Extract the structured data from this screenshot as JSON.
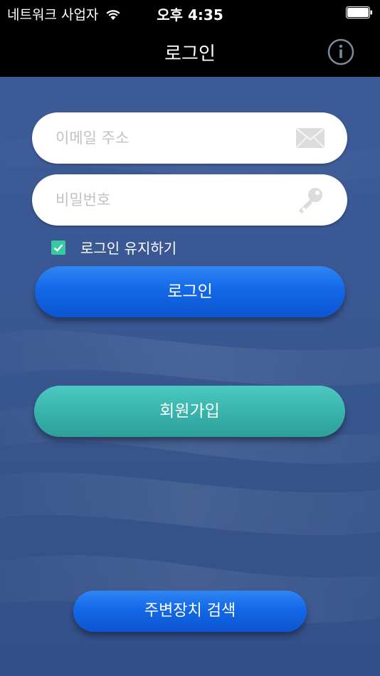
{
  "status_bar": {
    "carrier": "네트워크 사업자",
    "time": "오후 4:35",
    "icons": [
      "wifi-icon",
      "battery-icon"
    ]
  },
  "nav": {
    "title": "로그인",
    "info_icon": "info-icon"
  },
  "form": {
    "email": {
      "placeholder": "이메일 주소",
      "value": "",
      "icon": "envelope-icon"
    },
    "password": {
      "placeholder": "비밀번호",
      "value": "",
      "icon": "key-icon"
    },
    "remember": {
      "label": "로그인 유지하기",
      "checked": true
    }
  },
  "buttons": {
    "login": "로그인",
    "signup": "회원가입",
    "scan": "주변장치 검색"
  },
  "colors": {
    "background": "#3a5893",
    "primary_button": "#1368e8",
    "signup_button": "#38b5ad",
    "checkbox": "#38c9a3"
  }
}
